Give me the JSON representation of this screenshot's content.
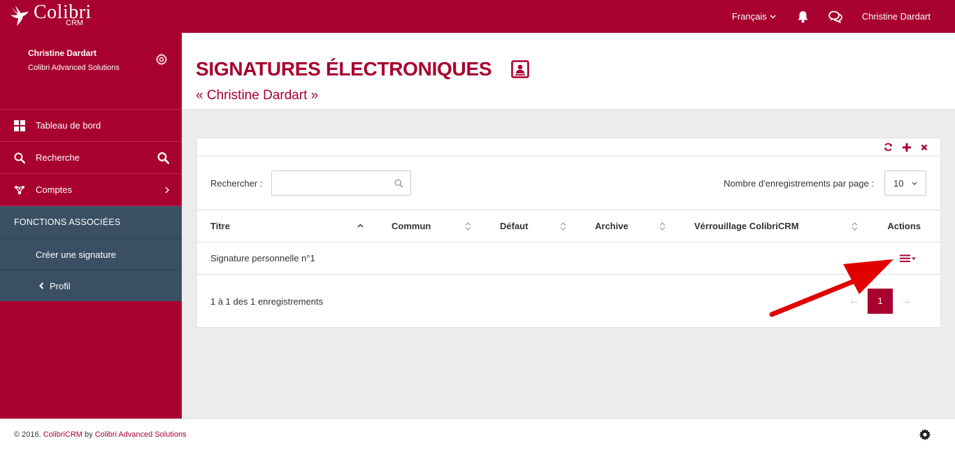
{
  "brand": {
    "name": "Colibri",
    "sub": "CRM"
  },
  "topbar": {
    "language": "Français",
    "user": "Christine Dardart"
  },
  "sidebar": {
    "profile_name": "Christine Dardart",
    "profile_org": "Colibri Advanced Solutions",
    "items": [
      {
        "label": "Tableau de bord",
        "icon": "grid-icon"
      },
      {
        "label": "Recherche",
        "icon": "search-icon"
      },
      {
        "label": "Comptes",
        "icon": "accounts-icon"
      }
    ],
    "section": "FONCTIONS ASSOCIÉES",
    "sub_items": [
      {
        "label": "Créer une signature"
      },
      {
        "label": "Profil"
      }
    ]
  },
  "header": {
    "title": "SIGNATURES ÉLECTRONIQUES",
    "subtitle": "« Christine Dardart »"
  },
  "panel": {
    "search_label": "Rechercher :",
    "search_value": "",
    "per_page_label": "Nombre d'enregistrements par page :",
    "per_page_value": "10",
    "columns": [
      "Titre",
      "Commun",
      "Défaut",
      "Archive",
      "Vérrouillage ColibriCRM",
      "Actions"
    ],
    "rows": [
      {
        "titre": "Signature personnelle n°1",
        "commun": "",
        "defaut": "",
        "archive": "",
        "verrou": ""
      }
    ],
    "info": "1 à 1 des 1 enregistrements",
    "pager": {
      "prev": "←",
      "current": "1",
      "next": "→"
    }
  },
  "footer": {
    "prefix": "© 2016. ",
    "product": "ColibriCRM",
    "by": " by ",
    "company": "Colibri Advanced Solutions"
  },
  "colors": {
    "brand": "#a8002f",
    "sidebar_section": "#3a4f63",
    "arrow": "#e00000"
  }
}
